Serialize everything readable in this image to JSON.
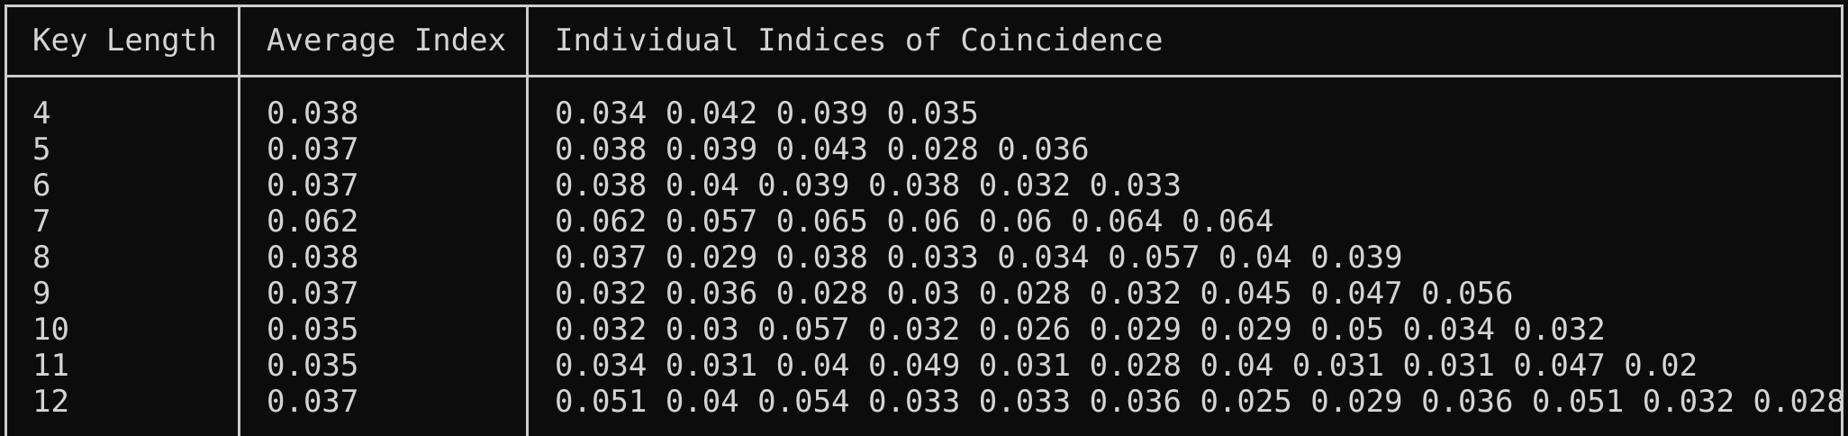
{
  "table": {
    "headers": [
      "Key Length",
      "Average Index",
      "Individual Indices of Coincidence"
    ],
    "rows": [
      {
        "key_length": "4",
        "average": "0.038",
        "indices": "0.034 0.042 0.039 0.035"
      },
      {
        "key_length": "5",
        "average": "0.037",
        "indices": "0.038 0.039 0.043 0.028 0.036"
      },
      {
        "key_length": "6",
        "average": "0.037",
        "indices": "0.038 0.04 0.039 0.038 0.032 0.033"
      },
      {
        "key_length": "7",
        "average": "0.062",
        "indices": "0.062 0.057 0.065 0.06 0.06 0.064 0.064"
      },
      {
        "key_length": "8",
        "average": "0.038",
        "indices": "0.037 0.029 0.038 0.033 0.034 0.057 0.04 0.039"
      },
      {
        "key_length": "9",
        "average": "0.037",
        "indices": "0.032 0.036 0.028 0.03 0.028 0.032 0.045 0.047 0.056"
      },
      {
        "key_length": "10",
        "average": "0.035",
        "indices": "0.032 0.03 0.057 0.032 0.026 0.029 0.029 0.05 0.034 0.032"
      },
      {
        "key_length": "11",
        "average": "0.035",
        "indices": "0.034 0.031 0.04 0.049 0.031 0.028 0.04 0.031 0.031 0.047 0.02"
      },
      {
        "key_length": "12",
        "average": "0.037",
        "indices": "0.051 0.04 0.054 0.033 0.033 0.036 0.025 0.029 0.036 0.051 0.032 0.028"
      }
    ]
  }
}
